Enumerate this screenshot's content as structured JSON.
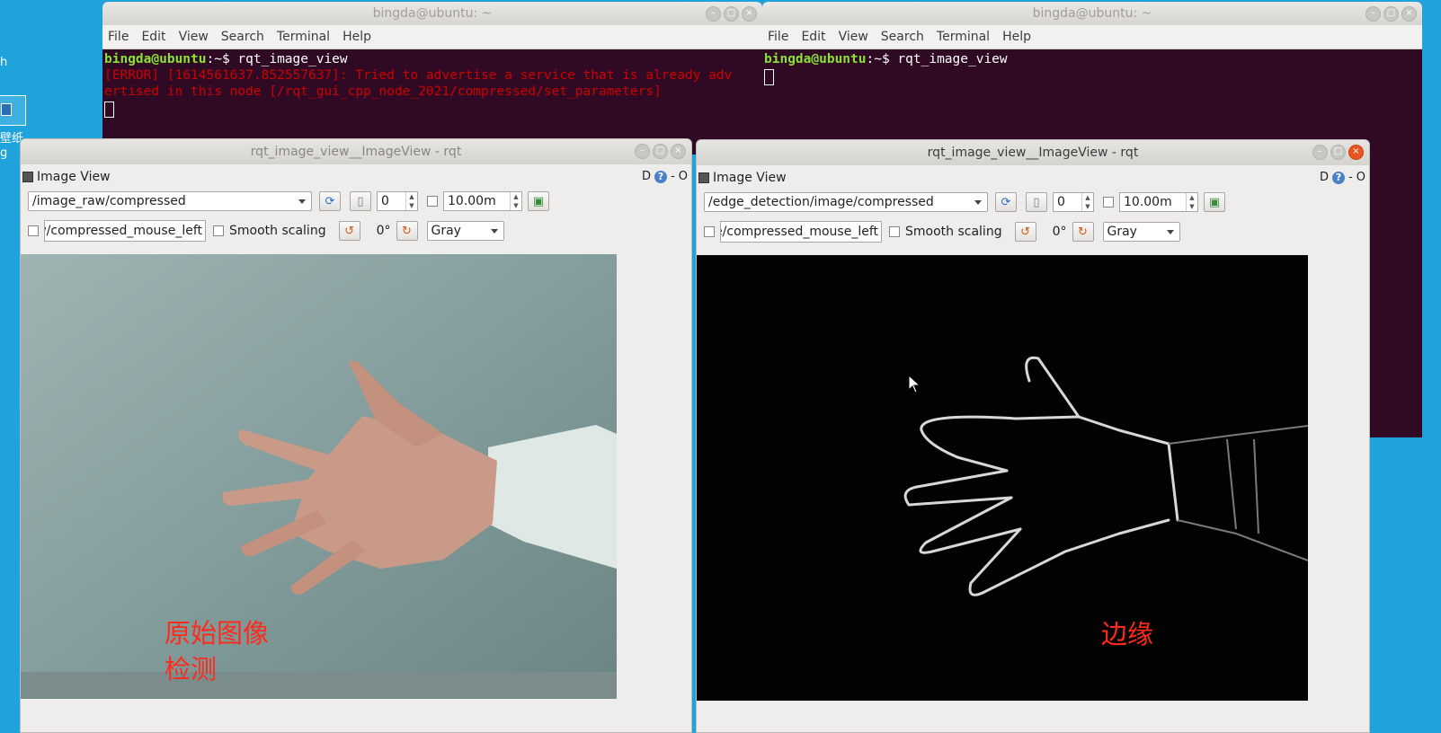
{
  "desktop": {
    "icon_label_1": "h",
    "icon_label_2": "壁纸",
    "icon_label_3": "g"
  },
  "terminal_left": {
    "title": "bingda@ubuntu: ~",
    "menu": [
      "File",
      "Edit",
      "View",
      "Search",
      "Terminal",
      "Help"
    ],
    "prompt_user": "bingda@ubuntu",
    "prompt_rest": ":~$ rqt_image_view",
    "error_line1": "[ERROR] [1614561637.852557637]: Tried to advertise a service that is already adv",
    "error_line2": "ertised in this node [/rqt_gui_cpp_node_2021/compressed/set_parameters]"
  },
  "terminal_right": {
    "title": "bingda@ubuntu: ~",
    "menu": [
      "File",
      "Edit",
      "View",
      "Search",
      "Terminal",
      "Help"
    ],
    "prompt_user": "bingda@ubuntu",
    "prompt_rest": ":~$ rqt_image_view"
  },
  "rqt_left": {
    "title": "rqt_image_view__ImageView - rqt",
    "dock_title": "Image View",
    "dock_btn_d": "D",
    "dock_btn_help": "?",
    "dock_btn_min": "-",
    "dock_btn_close": "O",
    "topic": "/image_raw/compressed",
    "spin_value": "0",
    "max_range": "10.00m",
    "mouse_topic": "w/compressed_mouse_left",
    "smooth_label": "Smooth scaling",
    "rotation": "0°",
    "color_scheme": "Gray",
    "caption_line1": "原始图像",
    "caption_line2": "检测"
  },
  "rqt_right": {
    "title": "rqt_image_view__ImageView - rqt",
    "dock_title": "Image View",
    "dock_btn_d": "D",
    "dock_btn_help": "?",
    "dock_btn_min": "-",
    "dock_btn_close": "O",
    "topic": "/edge_detection/image/compressed",
    "spin_value": "0",
    "max_range": "10.00m",
    "mouse_topic": "e/compressed_mouse_left",
    "smooth_label": "Smooth scaling",
    "rotation": "0°",
    "color_scheme": "Gray",
    "caption": "边缘"
  },
  "icons": {
    "refresh": "refresh-icon",
    "pause": "pause-icon",
    "save": "save-image-icon",
    "rotate_left": "rotate-left-icon",
    "rotate_right": "rotate-right-icon"
  }
}
